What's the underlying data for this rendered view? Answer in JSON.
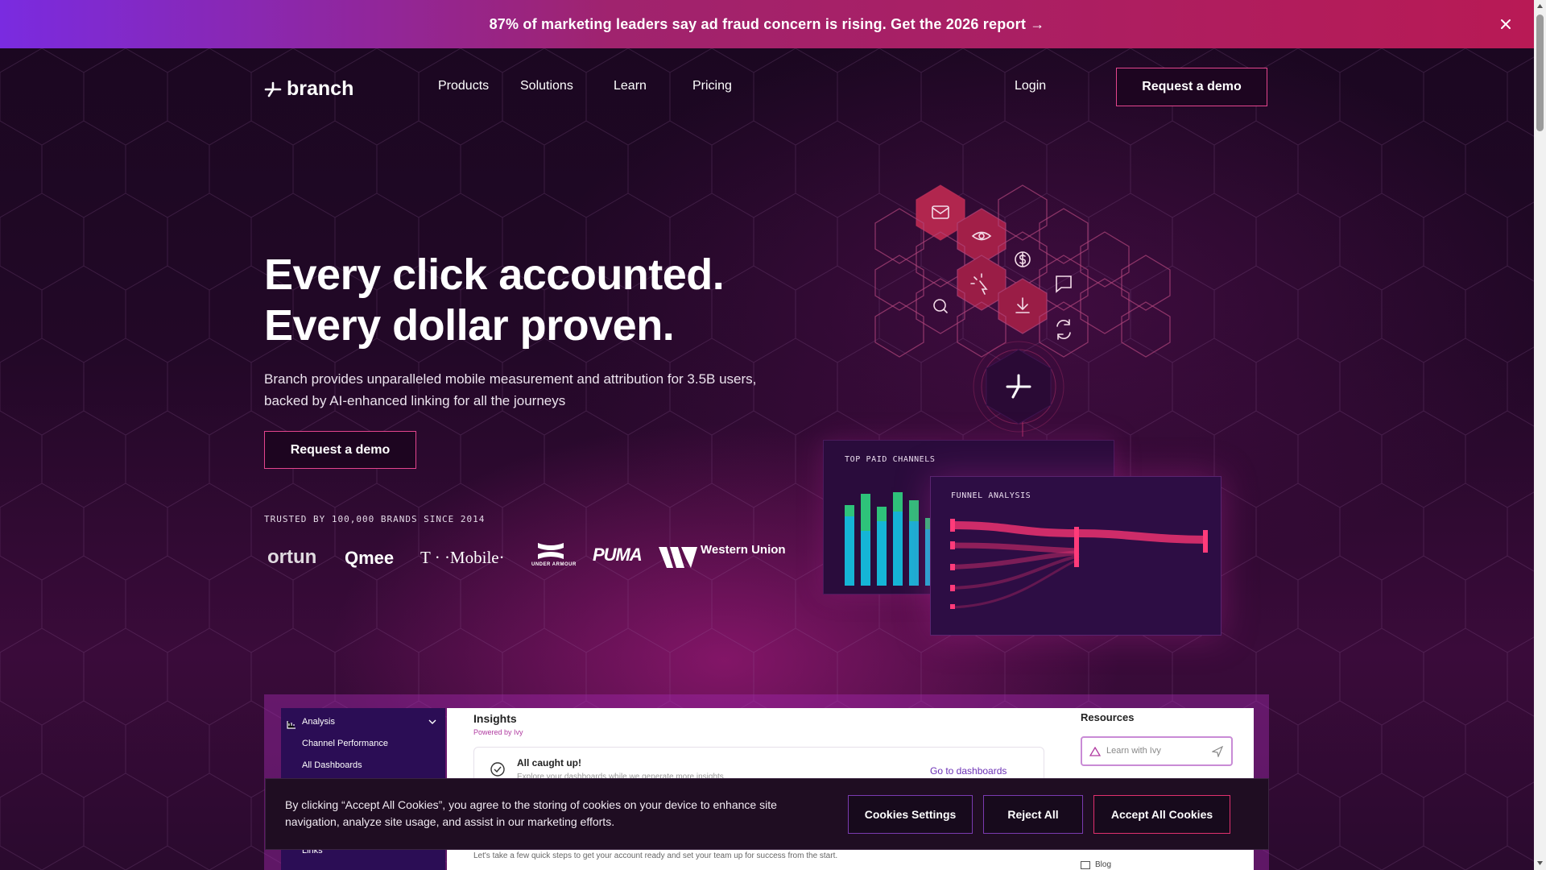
{
  "announcement": {
    "text": "87% of marketing leaders say ad fraud concern is rising. Get the 2026 report →",
    "close_icon": "close-icon"
  },
  "nav": {
    "logo_text": "branch",
    "links": [
      "Products",
      "Solutions",
      "Learn",
      "Pricing"
    ],
    "login": "Login",
    "cta": "Request a demo"
  },
  "hero": {
    "title_line1": "Every click accounted.",
    "title_line2": "Every dollar proven.",
    "subtitle": "Branch provides unparalleled mobile measurement and attribution for 3.5B users, backed by AI-enhanced linking for all the journeys",
    "cta": "Request a demo",
    "trusted": "TRUSTED BY 100,000 BRANDS SINCE 2014",
    "brand_logos": [
      "ortun",
      "Qmee",
      "T · ·Mobile·",
      "UNDER ARMOUR",
      "PUMA",
      "Western Union"
    ]
  },
  "illustration": {
    "icons": [
      "mail-icon",
      "eye-icon",
      "dollar-icon",
      "cursor-click-icon",
      "chat-icon",
      "search-icon",
      "download-icon",
      "refresh-icon",
      "branch-star-icon"
    ],
    "cards": {
      "top_paid_channels": "TOP PAID CHANNELS",
      "funnel_analysis": "FUNNEL ANALYSIS"
    },
    "colors": {
      "accent": "#e0306e",
      "teal": "#15b5d6",
      "green": "#2ec27a"
    }
  },
  "app_preview": {
    "sidebar": {
      "section": "Analysis",
      "items": [
        "Channel Performance",
        "All Dashboards",
        "Links"
      ]
    },
    "insights_title": "Insights",
    "powered_by": "Powered by Ivy",
    "caught_up": "All caught up!",
    "caught_up_sub": "Explore your dashboards while we generate more insights",
    "go_dashboards": "Go to dashboards",
    "setup_text": "Let's take a few quick steps to get your account ready and set your team up for success from the start.",
    "resources_title": "Resources",
    "ivy_placeholder": "Learn with Ivy",
    "blog_label": "Blog"
  },
  "cookie": {
    "text": "By clicking “Accept All Cookies”, you agree to the storing of cookies on your device to enhance site navigation, analyze site usage, and assist in our marketing efforts.",
    "settings": "Cookies Settings",
    "reject": "Reject All",
    "accept": "Accept All Cookies"
  }
}
